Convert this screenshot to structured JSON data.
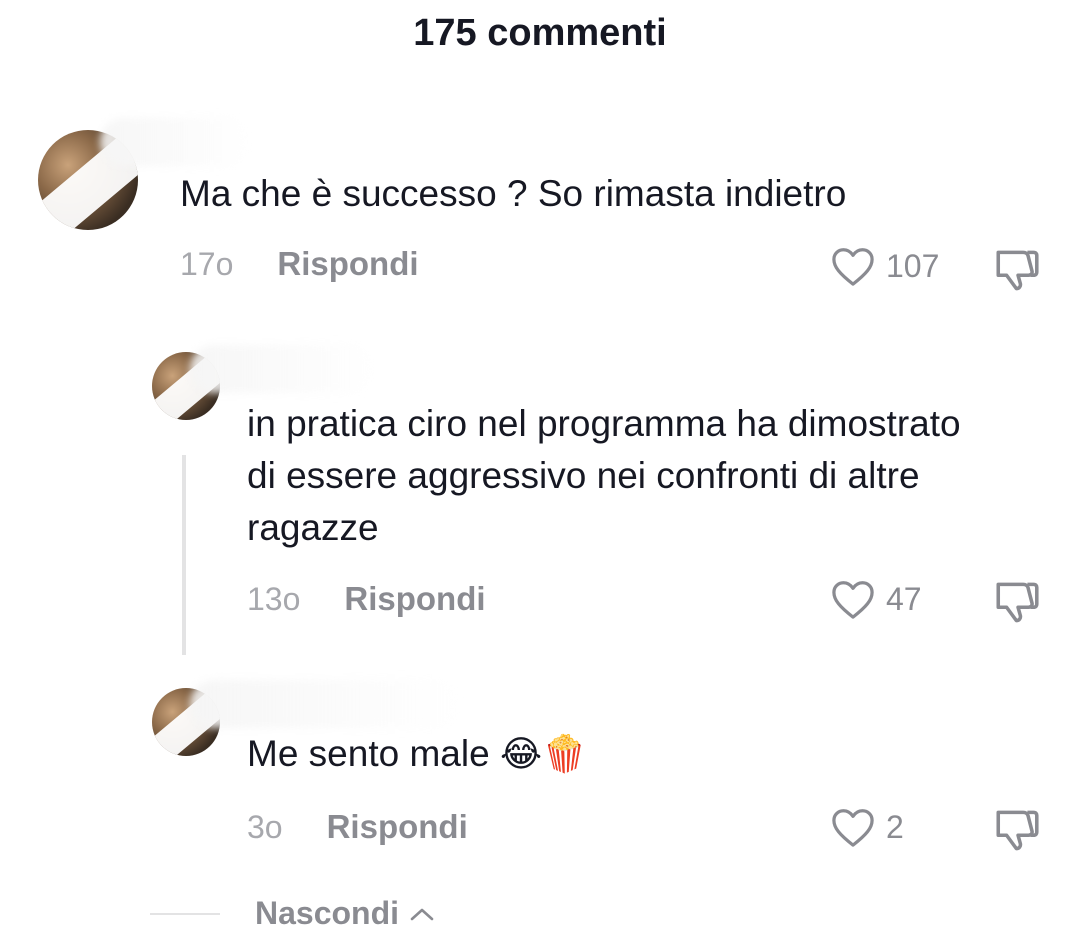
{
  "header": {
    "title": "175 commenti"
  },
  "comments": [
    {
      "text": "Ma che è successo ? So rimasta indietro",
      "time": "17o",
      "reply_label": "Rispondi",
      "likes": "107"
    },
    {
      "text": "in pratica ciro nel programma ha dimostrato di essere aggressivo nei confronti di altre ragazze",
      "time": "13o",
      "reply_label": "Rispondi",
      "likes": "47"
    },
    {
      "text": "Me sento male",
      "emoji": "😂🍿",
      "time": "3o",
      "reply_label": "Rispondi",
      "likes": "2"
    }
  ],
  "footer": {
    "hide_label": "Nascondi"
  },
  "icons": {
    "like": "heart-outline-icon",
    "dislike": "thumbs-down-icon",
    "chevron": "chevron-up-icon"
  },
  "colors": {
    "text": "#161823",
    "muted": "#8a8b91",
    "divider": "#e3e3e4"
  }
}
